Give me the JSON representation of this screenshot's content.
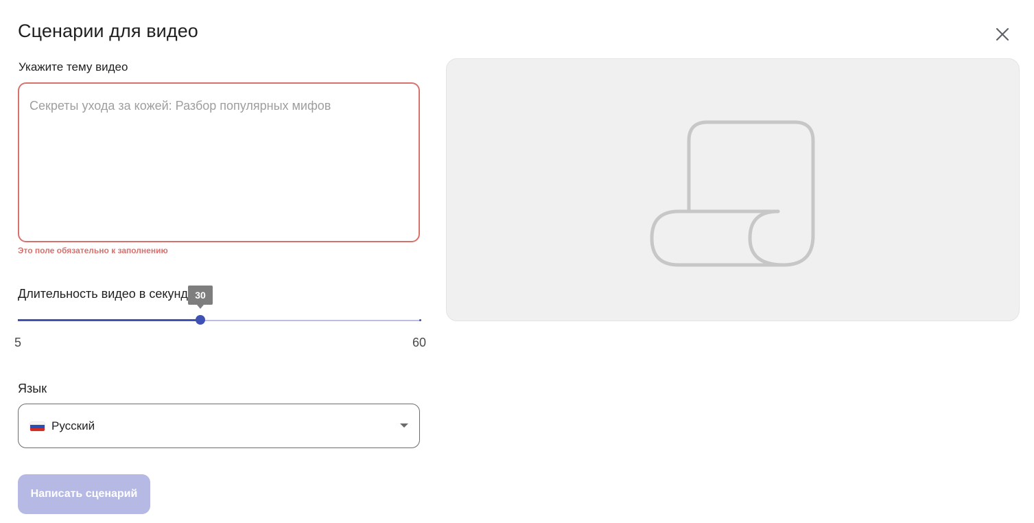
{
  "dialog": {
    "title": "Сценарии для видео",
    "close_icon": "close-icon"
  },
  "topic": {
    "label": "Укажите тему видео",
    "value": "",
    "placeholder": "Секреты ухода за кожей: Разбор популярных мифов",
    "error": "Это поле обязательно к заполнению",
    "error_color": "#d9706b"
  },
  "duration": {
    "label": "Длительность видео в секундах",
    "min": 5,
    "max": 60,
    "value": 30,
    "min_label": "5",
    "max_label": "60",
    "tooltip": "30",
    "accent_color": "#3f51b5"
  },
  "language": {
    "label": "Язык",
    "selected": "Русский",
    "flag_icon": "russia-flag-icon",
    "caret_icon": "chevron-down-icon"
  },
  "submit": {
    "label": "Написать сценарий",
    "disabled": true,
    "color": "#b5b9e3"
  },
  "preview": {
    "icon": "scroll-icon"
  }
}
